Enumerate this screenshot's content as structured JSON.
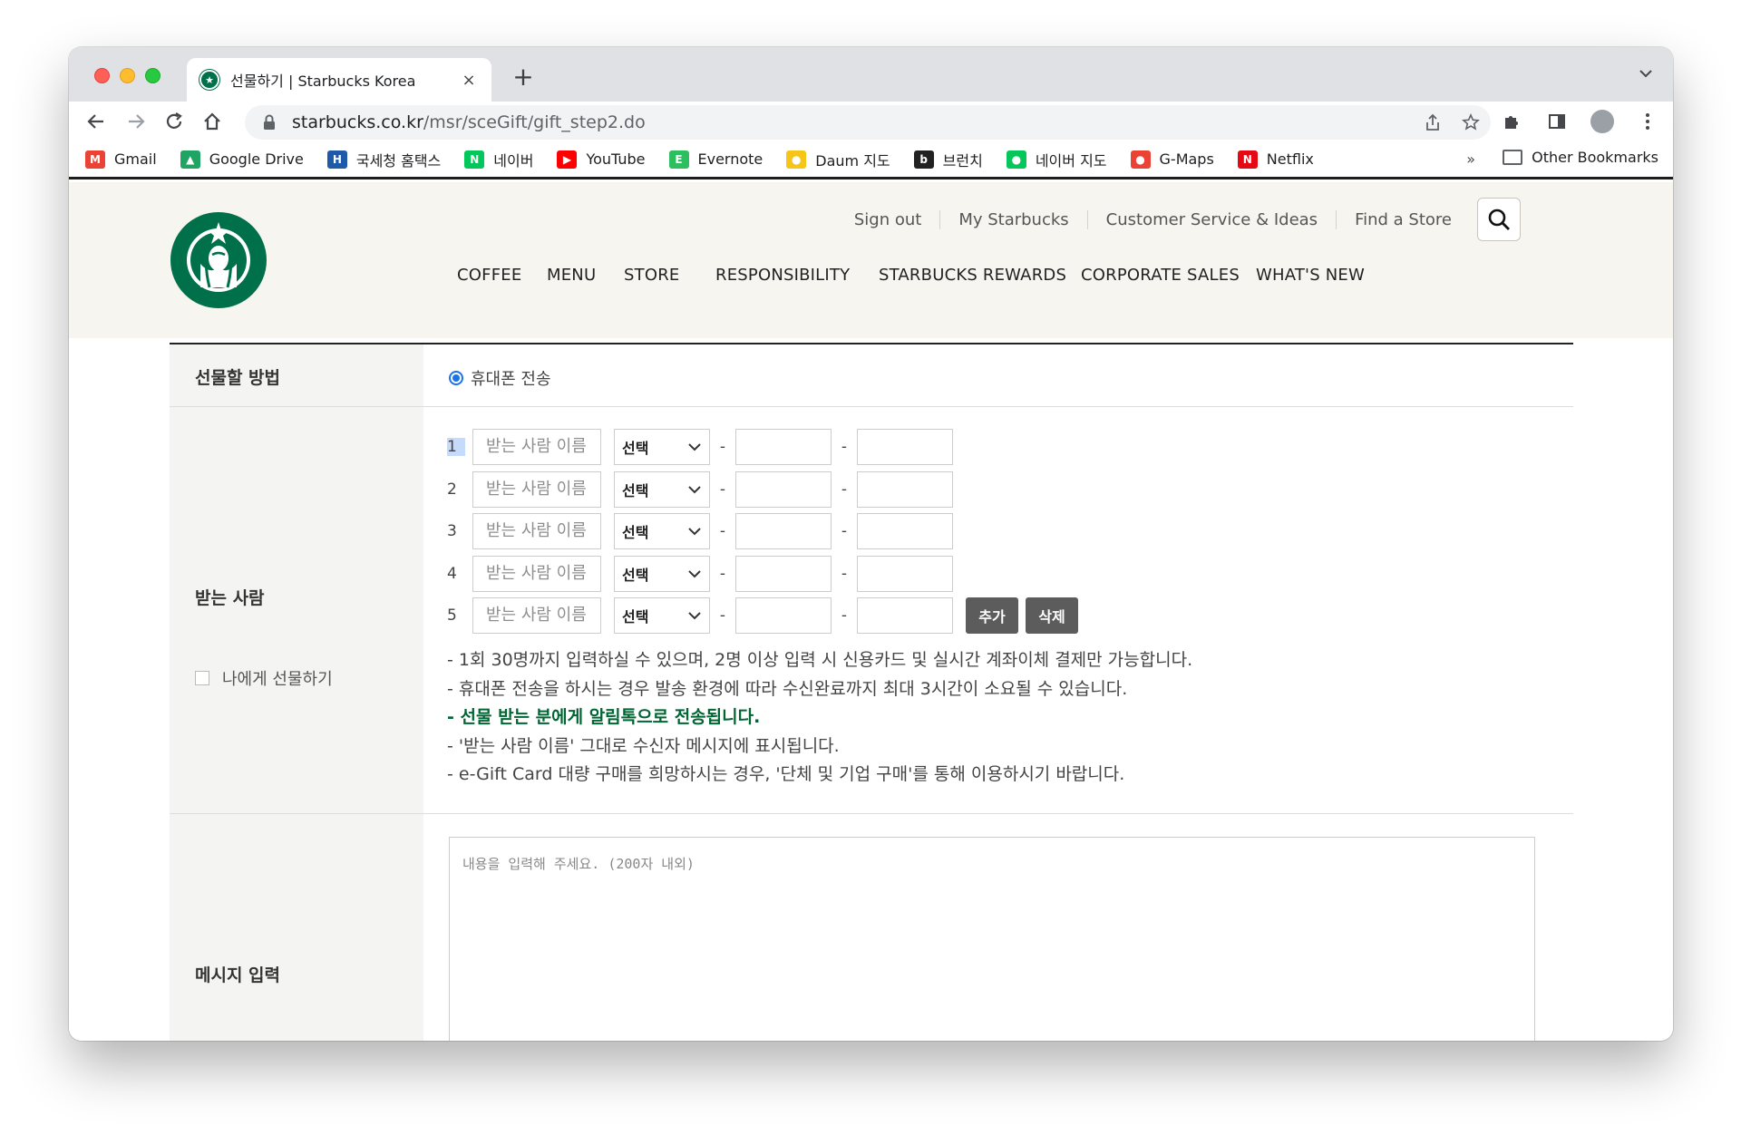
{
  "browser": {
    "tab_title": "선물하기 | Starbucks Korea",
    "tab_close": "×",
    "new_tab": "+",
    "url_host": "starbucks.co.kr",
    "url_path": "/msr/sceGift/gift_step2.do",
    "bookmarks": [
      {
        "label": "Gmail",
        "icon": "gmail-icon",
        "color": "#ea4335",
        "glyph": "M"
      },
      {
        "label": "Google Drive",
        "icon": "google-drive-icon",
        "color": "#1fa463",
        "glyph": "▲"
      },
      {
        "label": "국세청 홈택스",
        "icon": "hometax-icon",
        "color": "#1e5aa8",
        "glyph": "H"
      },
      {
        "label": "네이버",
        "icon": "naver-icon",
        "color": "#03c75a",
        "glyph": "N"
      },
      {
        "label": "YouTube",
        "icon": "youtube-icon",
        "color": "#ff0000",
        "glyph": "▶"
      },
      {
        "label": "Evernote",
        "icon": "evernote-icon",
        "color": "#2dbe60",
        "glyph": "E"
      },
      {
        "label": "Daum 지도",
        "icon": "daum-map-icon",
        "color": "#f5c518",
        "glyph": "●"
      },
      {
        "label": "브런치",
        "icon": "brunch-icon",
        "color": "#222222",
        "glyph": "b"
      },
      {
        "label": "네이버 지도",
        "icon": "naver-map-icon",
        "color": "#03c75a",
        "glyph": "●"
      },
      {
        "label": "G-Maps",
        "icon": "google-maps-icon",
        "color": "#ea4335",
        "glyph": "●"
      },
      {
        "label": "Netflix",
        "icon": "netflix-icon",
        "color": "#e50914",
        "glyph": "N"
      }
    ],
    "more_bookmarks": "»",
    "other_bookmarks": "Other Bookmarks"
  },
  "site": {
    "util_nav": [
      "Sign out",
      "My Starbucks",
      "Customer Service & Ideas",
      "Find a Store"
    ],
    "gnb": [
      "COFFEE",
      "MENU",
      "STORE",
      "RESPONSIBILITY",
      "STARBUCKS REWARDS",
      "CORPORATE SALES",
      "WHAT'S NEW"
    ],
    "brand_color": "#00704a"
  },
  "form": {
    "method_label": "선물할 방법",
    "method_option": "휴대폰 전송",
    "recipient_label": "받는 사람",
    "self_gift_label": "나에게 선물하기",
    "recipients": [
      {
        "num": "1",
        "name_placeholder": "받는 사람 이름",
        "select": "선택"
      },
      {
        "num": "2",
        "name_placeholder": "받는 사람 이름",
        "select": "선택"
      },
      {
        "num": "3",
        "name_placeholder": "받는 사람 이름",
        "select": "선택"
      },
      {
        "num": "4",
        "name_placeholder": "받는 사람 이름",
        "select": "선택"
      },
      {
        "num": "5",
        "name_placeholder": "받는 사람 이름",
        "select": "선택"
      }
    ],
    "dash": "-",
    "add_button": "추가",
    "delete_button": "삭제",
    "notes": [
      "- 1회 30명까지 입력하실 수 있으며, 2명 이상 입력 시 신용카드 및 실시간 계좌이체 결제만 가능합니다.",
      "- 휴대폰 전송을 하시는 경우 발송 환경에 따라 수신완료까지 최대 3시간이 소요될 수 있습니다.",
      "- 선물 받는 분에게 알림톡으로 전송됩니다.",
      "- '받는 사람 이름' 그대로 수신자 메시지에 표시됩니다.",
      "- e-Gift Card 대량 구매를 희망하시는 경우, '단체 및 기업 구매'를 통해 이용하시기 바랍니다."
    ],
    "message_label": "메시지 입력",
    "message_placeholder": "내용을 입력해 주세요. (200자 내외)"
  }
}
